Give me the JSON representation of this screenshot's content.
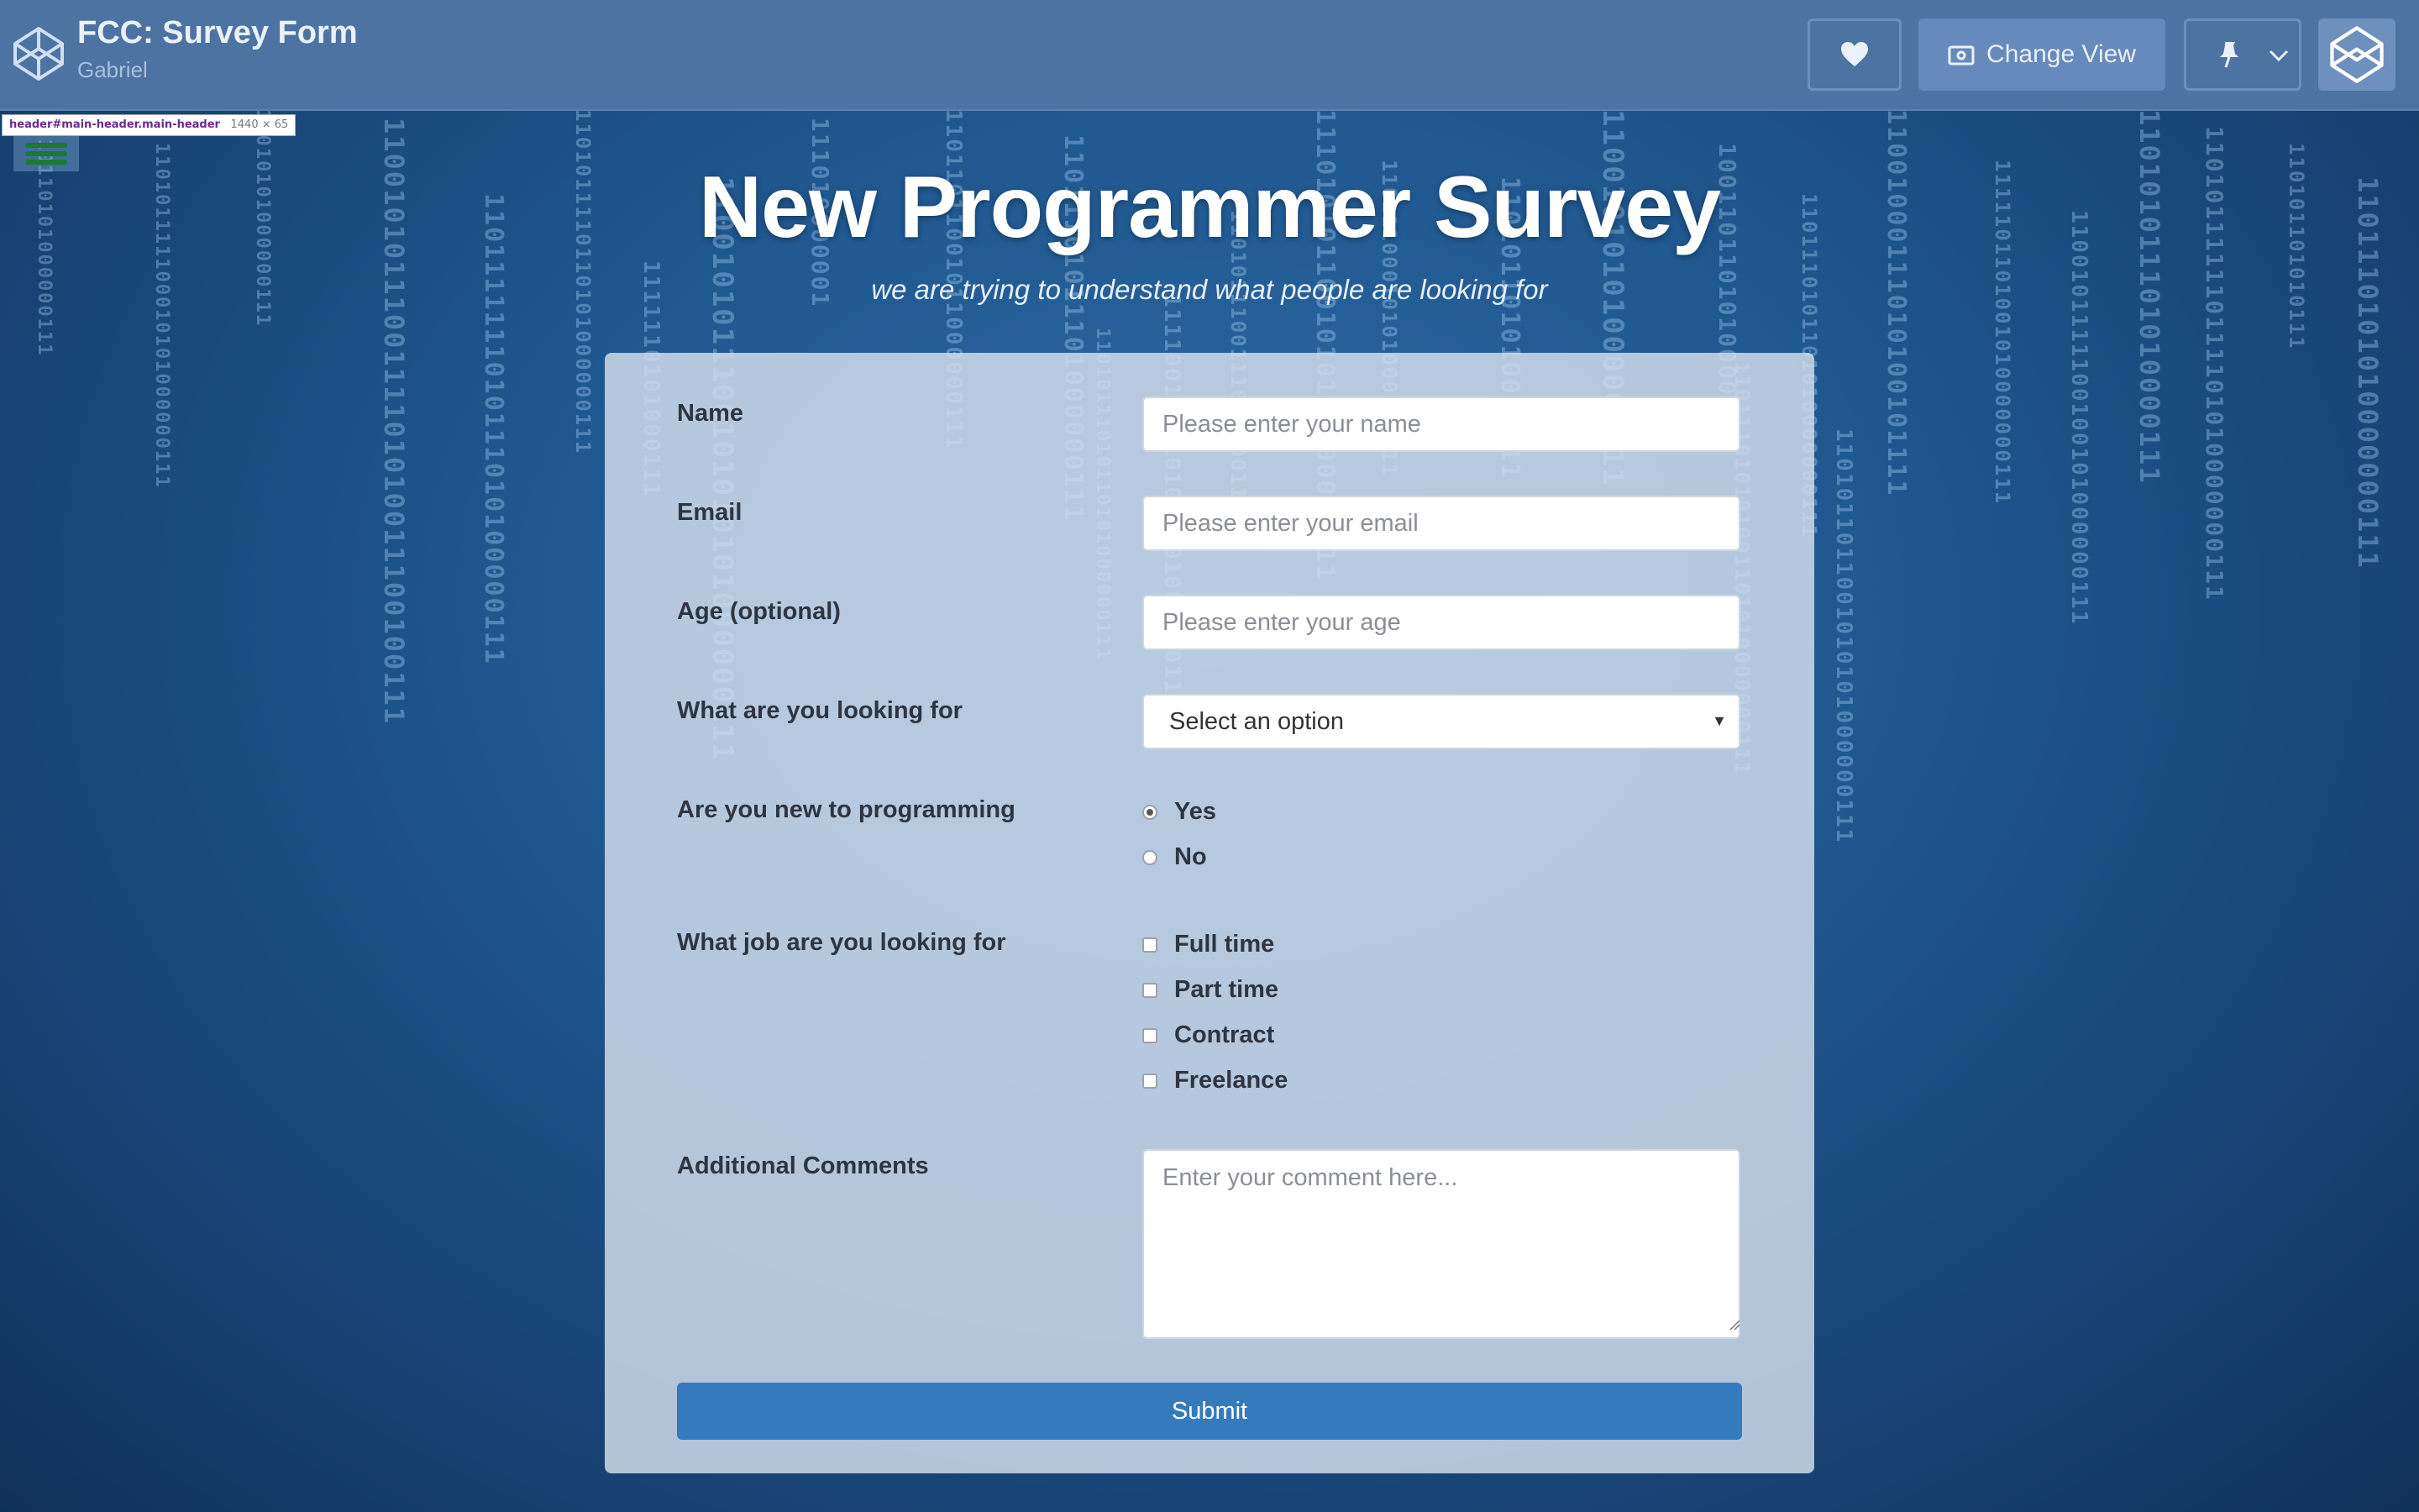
{
  "header": {
    "title": "FCC: Survey Form",
    "author": "Gabriel",
    "change_view_label": "Change View"
  },
  "inspector_tooltip": {
    "selector": "header#main-header.main-header",
    "dimensions": "1440 × 65"
  },
  "page": {
    "heading": "New Programmer Survey",
    "tagline": "we are trying to understand what people are looking for"
  },
  "form": {
    "name": {
      "label": "Name",
      "placeholder": "Please enter your name"
    },
    "email": {
      "label": "Email",
      "placeholder": "Please enter your email"
    },
    "age": {
      "label": "Age (optional)",
      "placeholder": "Please enter your age"
    },
    "looking_for": {
      "label": "What are you looking for",
      "selected": "Select an option"
    },
    "new_to_programming": {
      "label": "Are you new to programming",
      "options": [
        {
          "label": "Yes",
          "checked": true
        },
        {
          "label": "No",
          "checked": false
        }
      ]
    },
    "job_type": {
      "label": "What job are you looking for",
      "options": [
        {
          "label": "Full time",
          "checked": false
        },
        {
          "label": "Part time",
          "checked": false
        },
        {
          "label": "Contract",
          "checked": false
        },
        {
          "label": "Freelance",
          "checked": false
        }
      ]
    },
    "comments": {
      "label": "Additional Comments",
      "placeholder": "Enter your comment here..."
    },
    "submit_label": "Submit"
  },
  "colors": {
    "header_bg": "#4d73a3",
    "submit_bg": "#357abd",
    "hamburger": "#1a7a2e"
  },
  "matrix_columns": [
    "110110101000000111",
    "110101111100010101000000111",
    "11010101000000111",
    "1100101011100111101010011100100111",
    "1101111111010111010100000111",
    "1101011110110101000000111",
    "1100101011100101010101000000111",
    "111010000001",
    "11011011001011000000111",
    "11011101011101000000111",
    "1111001011101010101000000111",
    "1101011100111000000111",
    "1110101011001010101100000111",
    "11011100010101000000111",
    "110101101010000111",
    "11001010101000000111",
    "1001101101010000111",
    "1101110101101010000000111",
    "11001000111010100101111",
    "1111101101001010000000111",
    "1100101111100100101000000111",
    "110101011101010000111",
    "110101111110111101010000000111",
    "110101101010111",
    "1101110101010000000111",
    "110111010101001101010000000111",
    "11010111010110101000000111",
    "1111110101000111",
    "1101011011001010101000000111"
  ]
}
